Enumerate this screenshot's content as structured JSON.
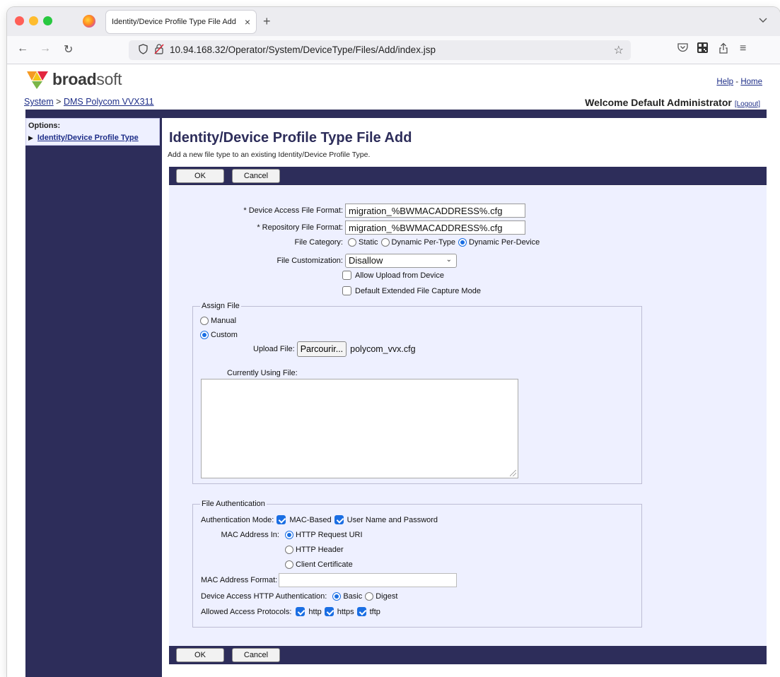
{
  "browser": {
    "tab_title": "Identity/Device Profile Type File Add",
    "url": "10.94.168.32/Operator/System/DeviceType/Files/Add/index.jsp"
  },
  "header": {
    "logo_bold": "broad",
    "logo_light": "soft",
    "help_link": "Help",
    "separator": "-",
    "home_link": "Home",
    "breadcrumb_root": "System",
    "breadcrumb_sep": ">",
    "breadcrumb_current": "DMS Polycom VVX311",
    "welcome": "Welcome Default Administrator",
    "logout": "[Logout]"
  },
  "sidebar": {
    "options_label": "Options:",
    "items": [
      {
        "label": "Identity/Device Profile Type"
      }
    ]
  },
  "main": {
    "title": "Identity/Device Profile Type File Add",
    "subtitle": "Add a new file type to an existing Identity/Device Profile Type.",
    "ok_label": "OK",
    "cancel_label": "Cancel"
  },
  "form": {
    "device_access_label": "* Device Access File Format:",
    "device_access_value": "migration_%BWMACADDRESS%.cfg",
    "repository_label": "* Repository File Format:",
    "repository_value": "migration_%BWMACADDRESS%.cfg",
    "file_category_label": "File Category:",
    "category_options": [
      "Static",
      "Dynamic Per-Type",
      "Dynamic Per-Device"
    ],
    "category_selected": "Dynamic Per-Device",
    "file_customization_label": "File Customization:",
    "file_customization_value": "Disallow",
    "allow_upload_label": "Allow Upload from Device",
    "allow_upload_checked": false,
    "extended_capture_label": "Default Extended File Capture Mode",
    "extended_capture_checked": false
  },
  "assign_file": {
    "legend": "Assign File",
    "manual_label": "Manual",
    "custom_label": "Custom",
    "selected": "Custom",
    "upload_label": "Upload File:",
    "browse_button": "Parcourir...",
    "selected_file": "polycom_vvx.cfg",
    "currently_using_label": "Currently Using File:"
  },
  "file_auth": {
    "legend": "File Authentication",
    "auth_mode_label": "Authentication Mode:",
    "mac_based_label": "MAC-Based",
    "user_pass_label": "User Name and Password",
    "mac_in_label": "MAC Address In:",
    "mac_in_options": [
      "HTTP Request URI",
      "HTTP Header",
      "Client Certificate"
    ],
    "mac_in_selected": "HTTP Request URI",
    "mac_format_label": "MAC Address Format:",
    "mac_format_value": "",
    "http_auth_label": "Device Access HTTP Authentication:",
    "http_auth_basic": "Basic",
    "http_auth_digest": "Digest",
    "http_auth_selected": "Basic",
    "protocols_label": "Allowed Access Protocols:",
    "protocols": [
      "http",
      "https",
      "tftp"
    ]
  },
  "colors": {
    "nav_bg": "#2d2d5a",
    "panel_bg": "#eef0ff",
    "link": "#1e2e88",
    "accent": "#1a6ee3"
  }
}
